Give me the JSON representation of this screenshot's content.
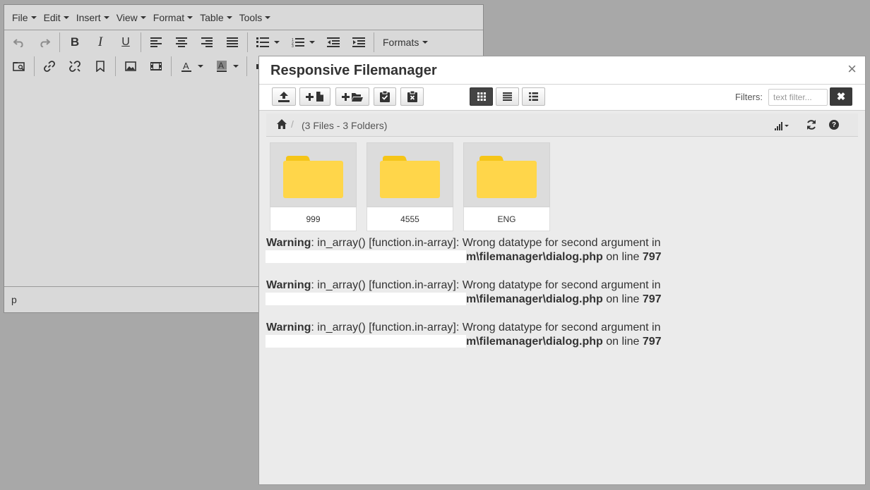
{
  "editor": {
    "menus": [
      "File",
      "Edit",
      "Insert",
      "View",
      "Format",
      "Table",
      "Tools"
    ],
    "formats_label": "Formats",
    "status_path": "p"
  },
  "dialog": {
    "title": "Responsive Filemanager",
    "close_symbol": "×",
    "filters_label": "Filters:",
    "filter_placeholder": "text filter...",
    "filter_clear_symbol": "✖",
    "breadcrumb": {
      "separator": "/",
      "summary": "(3 Files - 3 Folders)",
      "help_symbol": "?"
    },
    "folders": [
      {
        "name": "999"
      },
      {
        "name": "4555"
      },
      {
        "name": "ENG"
      }
    ],
    "warnings": [
      {
        "label": "Warning",
        "message": ": in_array() [function.in-array]: Wrong datatype for second argument in",
        "path": "m\\filemanager\\dialog.php",
        "line_text": " on line ",
        "line_number": "797"
      },
      {
        "label": "Warning",
        "message": ": in_array() [function.in-array]: Wrong datatype for second argument in",
        "path": "m\\filemanager\\dialog.php",
        "line_text": " on line ",
        "line_number": "797"
      },
      {
        "label": "Warning",
        "message": ": in_array() [function.in-array]: Wrong datatype for second argument in",
        "path": "m\\filemanager\\dialog.php",
        "line_text": " on line ",
        "line_number": "797"
      }
    ]
  },
  "colors": {
    "folder_yellow": "#ffd64a",
    "folder_tab": "#f5c518",
    "active_view": "#444444",
    "backdrop": "#a8a8a8"
  }
}
